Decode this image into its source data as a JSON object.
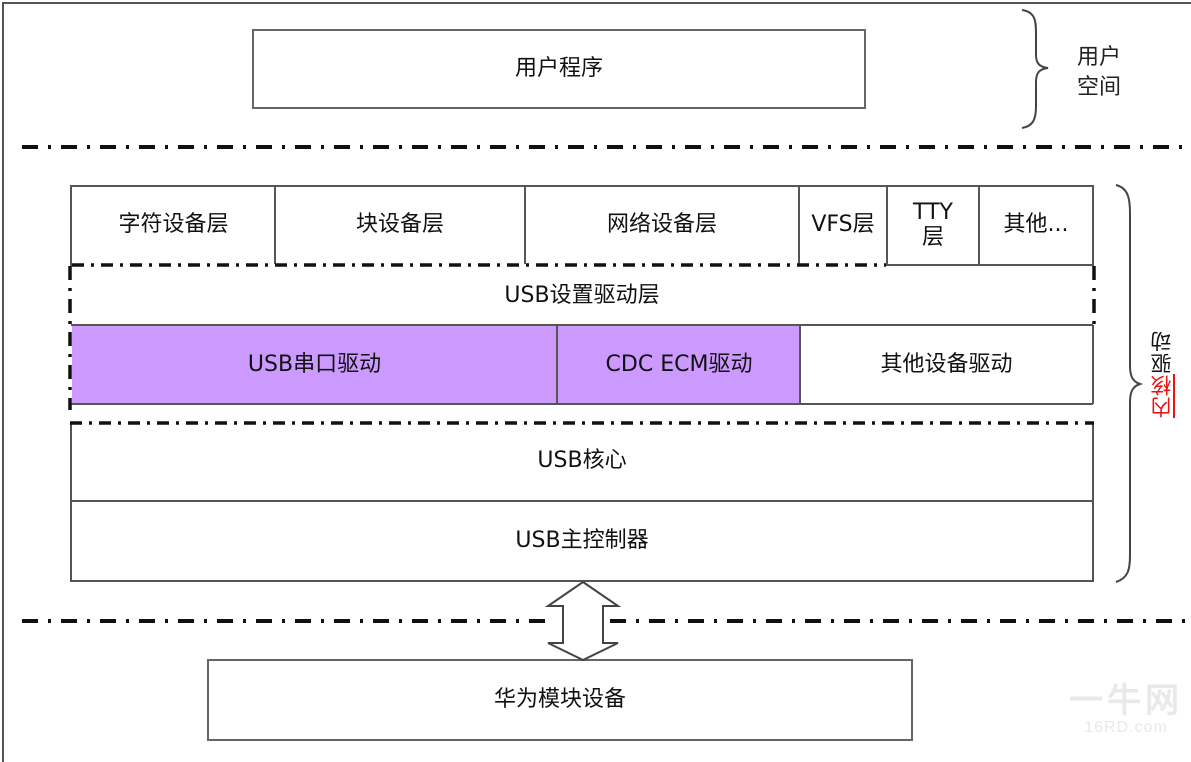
{
  "user_space": {
    "program_box": "用户程序",
    "brace_label_line1": "用户",
    "brace_label_line2": "空间"
  },
  "kernel": {
    "top_layers": [
      {
        "label": "字符设备层"
      },
      {
        "label": "块设备层"
      },
      {
        "label": "网络设备层"
      },
      {
        "label": "VFS层"
      },
      {
        "label": "TTY\n层"
      },
      {
        "label": "其他..."
      }
    ],
    "usb_device_driver_layer": "USB设置驱动层",
    "drivers": [
      {
        "label": "USB串口驱动",
        "highlighted": true
      },
      {
        "label": "CDC ECM驱动",
        "highlighted": true
      },
      {
        "label": "其他设备驱动",
        "highlighted": false
      }
    ],
    "usb_core": "USB核心",
    "usb_host_controller": "USB主控制器",
    "brace_label_red": "内核",
    "brace_label_black": "驱动"
  },
  "hardware": {
    "device_box": "华为模块设备"
  },
  "colors": {
    "highlight": "#cc99ff",
    "kernel_label_accent": "#ee1111",
    "border": "#555555"
  },
  "watermark": {
    "main": "一牛网",
    "sub": "16RD.com"
  }
}
